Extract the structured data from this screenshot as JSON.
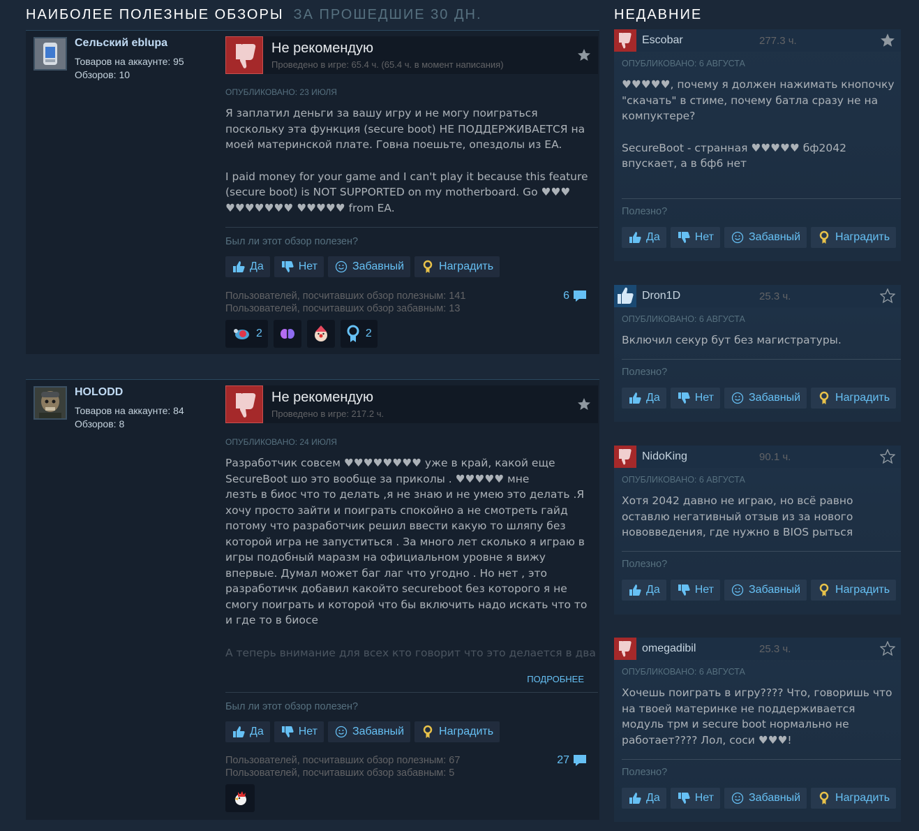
{
  "left_header": {
    "title": "НАИБОЛЕЕ ПОЛЕЗНЫЕ ОБЗОРЫ",
    "subtitle": "ЗА ПРОШЕДШИЕ 30 ДН."
  },
  "right_header": {
    "title": "НЕДАВНИЕ"
  },
  "icons": {
    "thumbs_down": "thumbs-down-icon",
    "thumbs_up": "thumbs-up-icon",
    "star": "star-icon",
    "smile": "smile-icon",
    "award": "award-icon",
    "comment": "comment-icon"
  },
  "colors": {
    "background": "#1b2838",
    "review_bg": "#16202d",
    "negative": "#a5292a",
    "positive": "#1a4972",
    "link": "#66c0f4"
  },
  "buttons": {
    "yes": "Да",
    "no": "Нет",
    "funny": "Забавный",
    "award": "Наградить"
  },
  "reviews": [
    {
      "author": "Сельский eblupa",
      "products": "Товаров на аккаунте: 95",
      "reviews_count": "Обзоров: 10",
      "verdict": "Не рекомендую",
      "hours": "Проведено в игре: 65.4 ч. (65.4 ч. в момент написания)",
      "posted": "ОПУБЛИКОВАНО: 23 ИЮЛЯ",
      "paragraphs": [
        "Я заплатил деньги за вашу игру и не могу поиграться поскольку эта функция (secure boot) НЕ ПОДДЕРЖИВАЕТСЯ на моей материнской плате. Говна поешьте, опездолы из EA.",
        "I paid money for your game and I can't play it because this feature (secure boot) is NOT SUPPORTED on my motherboard. Go ♥♥♥ ♥♥♥♥♥♥♥ ♥♥♥♥♥ from EA."
      ],
      "helpful_question": "Был ли этот обзор полезен?",
      "helpful_count": "Пользователей, посчитавших обзор полезным: 141",
      "funny_count": "Пользователей, посчитавших обзор забавным: 13",
      "comments": "6",
      "awards": [
        {
          "icon": "fish-award-icon",
          "count": "2"
        },
        {
          "icon": "butterfly-award-icon",
          "count": ""
        },
        {
          "icon": "clown-award-icon",
          "count": ""
        },
        {
          "icon": "ribbon-award-icon",
          "count": "2"
        }
      ]
    },
    {
      "author": "HOLODD",
      "products": "Товаров на аккаунте: 84",
      "reviews_count": "Обзоров: 8",
      "verdict": "Не рекомендую",
      "hours": "Проведено в игре: 217.2 ч.",
      "posted": "ОПУБЛИКОВАНО: 24 ИЮЛЯ",
      "paragraphs": [
        "Разработчик совсем ♥♥♥♥♥♥♥♥ уже в край, какой еще\nSecureBoot шо это вообще за приколы . ♥♥♥♥♥ мне\nлезть в биос что то делать ,я не знаю и не умею это делать .Я хочу просто зайти и поиграть спокойно а не смотреть гайд потому что разработчик решил ввести какую то шляпу без которой игра не запуститься . За много лет сколько я играю в игры подобный маразм на официальном уровне я вижу впервые. Думал может баг лаг что угодно . Но нет , это разработичк добавил какойто secureboot без которого я не смогу поиграть и которой что бы включить надо искать что то и где то в биосе"
      ],
      "fade_text": "А теперь внимание для всех кто говорит что это делается в два",
      "read_more": "ПОДРОБНЕЕ",
      "helpful_question": "Был ли этот обзор полезен?",
      "helpful_count": "Пользователей, посчитавших обзор полезным: 67",
      "funny_count": "Пользователей, посчитавших обзор забавным: 5",
      "comments": "27",
      "awards": [
        {
          "icon": "rooster-award-icon",
          "count": ""
        }
      ]
    }
  ],
  "recent": [
    {
      "name": "Escobar",
      "hours": "277.3 ч.",
      "verdict": "negative",
      "posted": "ОПУБЛИКОВАНО: 6 АВГУСТА",
      "paragraphs": [
        "♥♥♥♥♥, почему я должен нажимать кнопочку \"скачать\" в стиме, почему батла сразу не на компуктере?",
        "",
        "SecureBoot - странная ♥♥♥♥♥ бф2042 впускает, а в бф6 нет"
      ],
      "helpful_question": "Полезно?"
    },
    {
      "name": "Dron1D",
      "hours": "25.3 ч.",
      "verdict": "positive",
      "posted": "ОПУБЛИКОВАНО: 6 АВГУСТА",
      "paragraphs": [
        "Включил секур бут без магистратуры."
      ],
      "helpful_question": "Полезно?"
    },
    {
      "name": "NidoKing",
      "hours": "90.1 ч.",
      "verdict": "negative",
      "posted": "ОПУБЛИКОВАНО: 6 АВГУСТА",
      "paragraphs": [
        "Хотя 2042 давно не играю, но всё равно оставлю негативный отзыв из за нового нововведения, где нужно в BIOS рыться"
      ],
      "helpful_question": "Полезно?"
    },
    {
      "name": "omegadibil",
      "hours": "25.3 ч.",
      "verdict": "negative",
      "posted": "ОПУБЛИКОВАНО: 6 АВГУСТА",
      "paragraphs": [
        "Хочешь поиграть в игру???? Что, говоришь что на твоей материнке не поддерживается модуль трм и secure boot нормально не работает???? Лол, соси ♥♥♥!"
      ],
      "helpful_question": "Полезно?"
    }
  ]
}
